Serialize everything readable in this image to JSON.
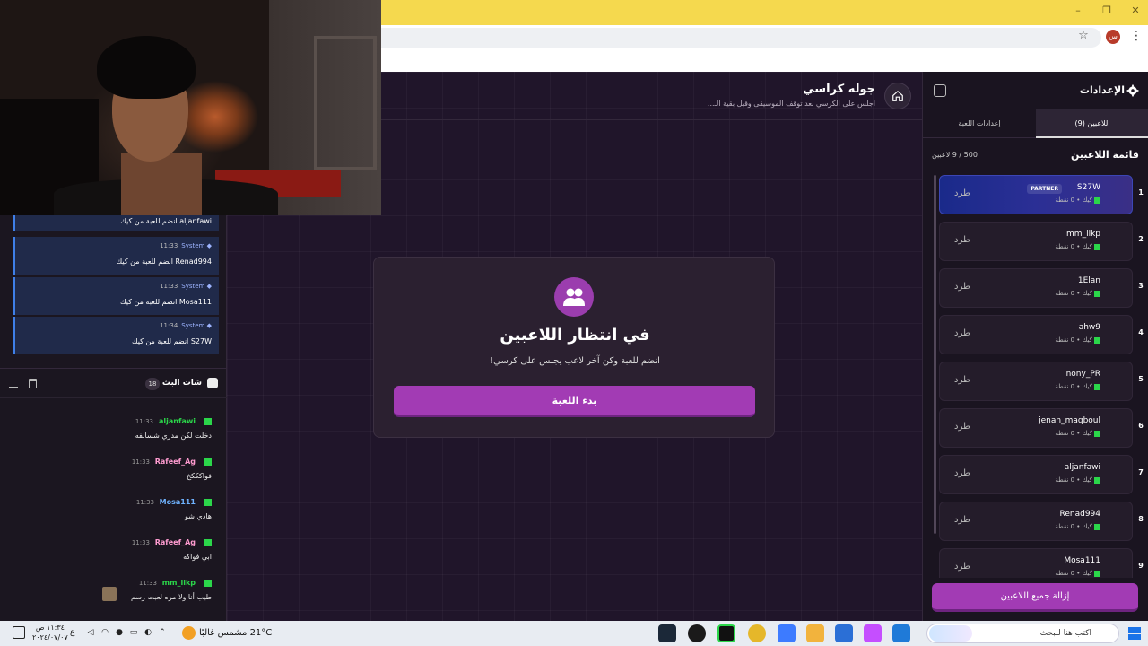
{
  "browser": {
    "window_controls": [
      "–",
      "❐",
      "✕"
    ],
    "profile_letter": "س"
  },
  "game": {
    "title": "جوله كراسي",
    "subtitle": "اجلس على الكرسي بعد توقف الموسيقى وقبل بقية الـ...",
    "waiting_title": "في انتظار اللاعبين",
    "waiting_subtitle": "انضم للعبة وكن آخر لاعب يجلس على كرسي!",
    "start_button": "بدء اللعبة"
  },
  "settings_panel": {
    "title": "الإعدادات",
    "tabs": [
      {
        "label": "اللاعبين (9)",
        "active": true
      },
      {
        "label": "إعدادات اللعبة",
        "active": false
      }
    ],
    "list_title": "قائمة اللاعبين",
    "player_count": "500 / 9 لاعبين",
    "kick_label": "طرد",
    "partner_badge": "PARTNER",
    "meta_text": "كيك • 0 نقطة",
    "remove_all_button": "إزالة جميع اللاعبين",
    "players": [
      {
        "num": "1",
        "name": "S27W",
        "partner": true
      },
      {
        "num": "2",
        "name": "mm_iikp",
        "partner": false
      },
      {
        "num": "3",
        "name": "1Elan",
        "partner": false
      },
      {
        "num": "4",
        "name": "ahw9",
        "partner": false
      },
      {
        "num": "5",
        "name": "nony_PR",
        "partner": false
      },
      {
        "num": "6",
        "name": "jenan_maqboul",
        "partner": false
      },
      {
        "num": "7",
        "name": "aljanfawi",
        "partner": false
      },
      {
        "num": "8",
        "name": "Renad994",
        "partner": false
      },
      {
        "num": "9",
        "name": "Mosa111",
        "partner": false
      }
    ]
  },
  "system_feed": {
    "sender": "System",
    "messages": [
      {
        "time": "",
        "text": "aljanfawi انضم للعبة من كيك"
      },
      {
        "time": "11:33",
        "text": "Renad994 انضم للعبة من كيك"
      },
      {
        "time": "11:33",
        "text": "Mosa111 انضم للعبة من كيك"
      },
      {
        "time": "11:34",
        "text": "S27W انضم للعبة من كيك"
      }
    ]
  },
  "chat": {
    "title": "شات البث",
    "badge": "18",
    "messages": [
      {
        "user": "aljanfawi",
        "time": "11:33",
        "text": "دخلت لكن مدري شسالفه",
        "color": "#2bd64a"
      },
      {
        "user": "Rafeef_Ag",
        "time": "11:33",
        "text": "فواكككخ",
        "color": "#ff9bd0"
      },
      {
        "user": "Mosa111",
        "time": "11:33",
        "text": "هاذي شو",
        "color": "#6fb3ff"
      },
      {
        "user": "Rafeef_Ag",
        "time": "11:33",
        "text": "ابي فواكه",
        "color": "#ff9bd0"
      },
      {
        "user": "mm_iikp",
        "time": "11:33",
        "text": "طيب أنا ولا مره لعبت رسم",
        "color": "#2bd64a"
      }
    ]
  },
  "taskbar": {
    "search_placeholder": "اكتب هنا للبحث",
    "weather": "21°C  مشمس غالبًا",
    "time": "١١:٣٤ ص",
    "date": "٢٠٢٤/٠٧/٠٧",
    "lang": "ع"
  },
  "colors": {
    "accent": "#a23bb4",
    "kick_green": "#2bd64a",
    "system_blue": "#3f7fe8"
  }
}
